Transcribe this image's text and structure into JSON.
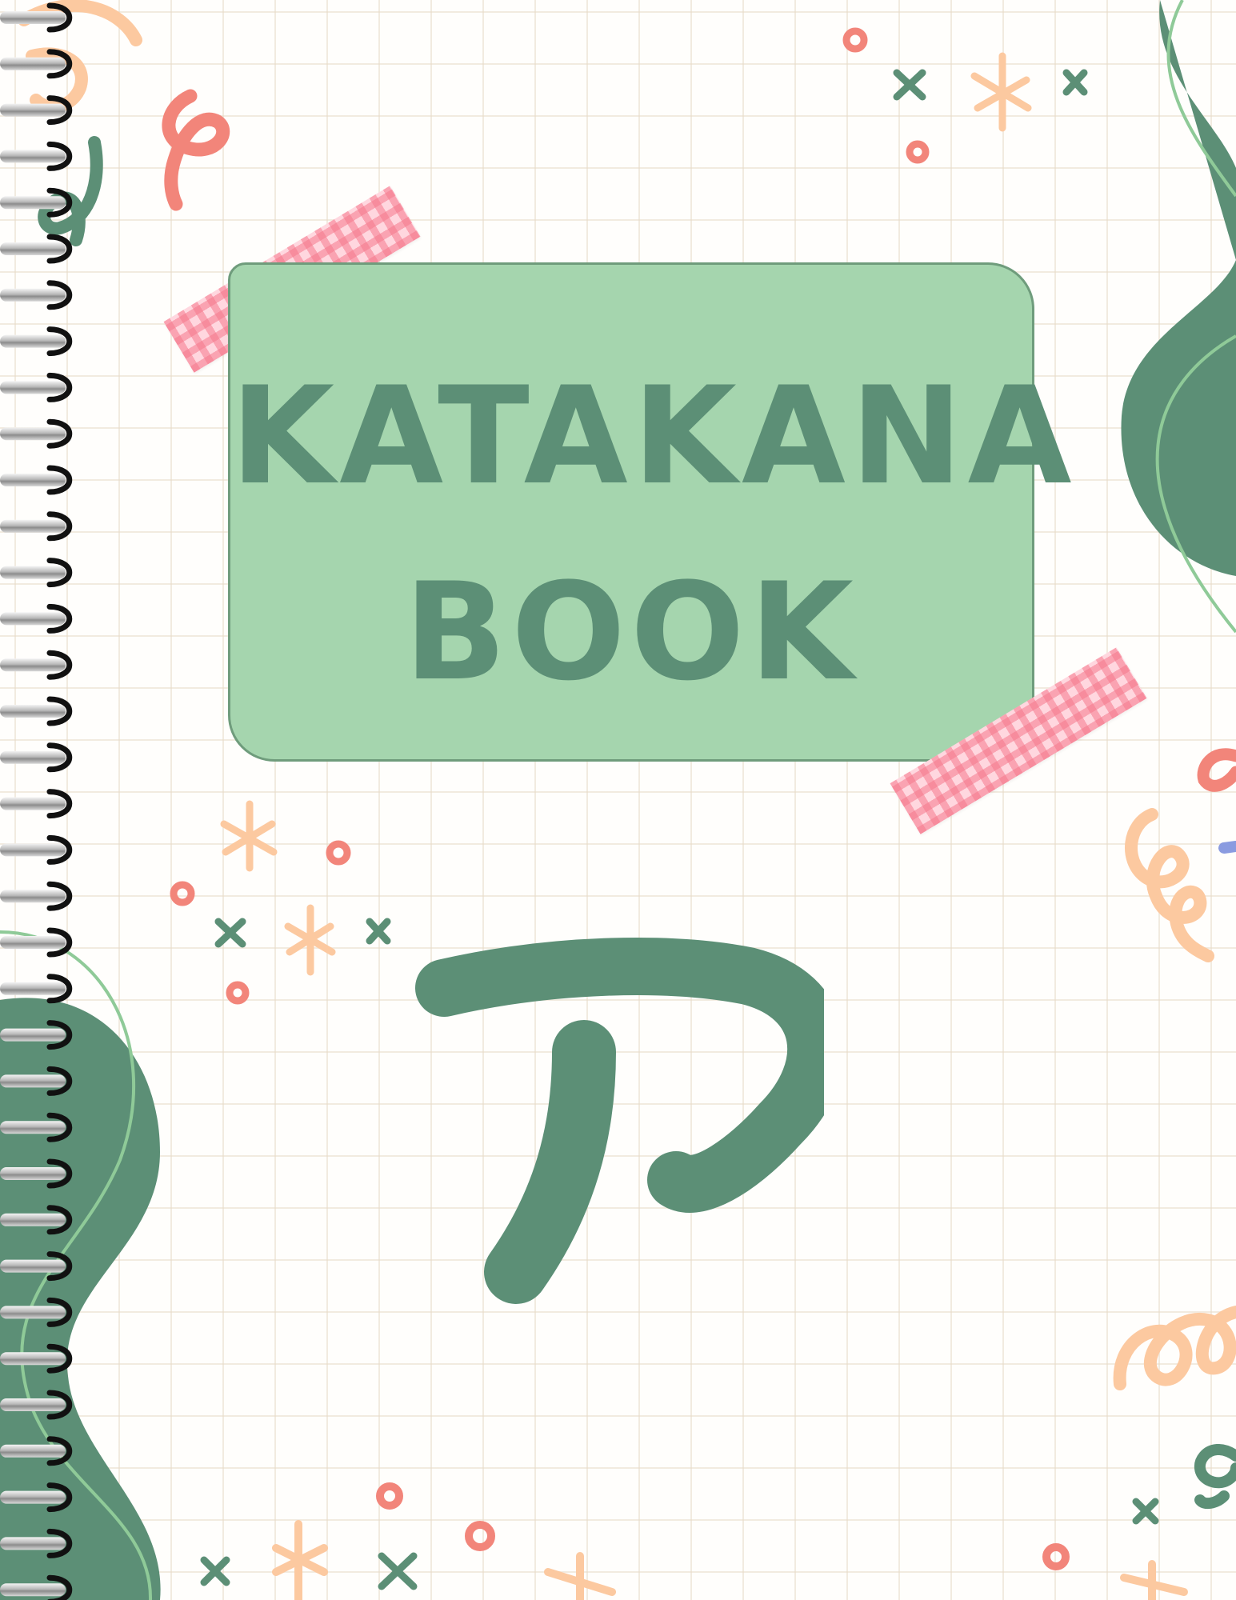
{
  "cover": {
    "title_line_1": "KATAKANA",
    "title_line_2": "BOOK",
    "featured_character_icon": "katakana-a-icon"
  },
  "colors": {
    "card_fill": "#a5d5ae",
    "accent_green": "#5c8f76",
    "light_green": "#8fca98",
    "coral": "#f2857a",
    "peach": "#fcc9a0",
    "tape_pink": "#ffd7df"
  }
}
